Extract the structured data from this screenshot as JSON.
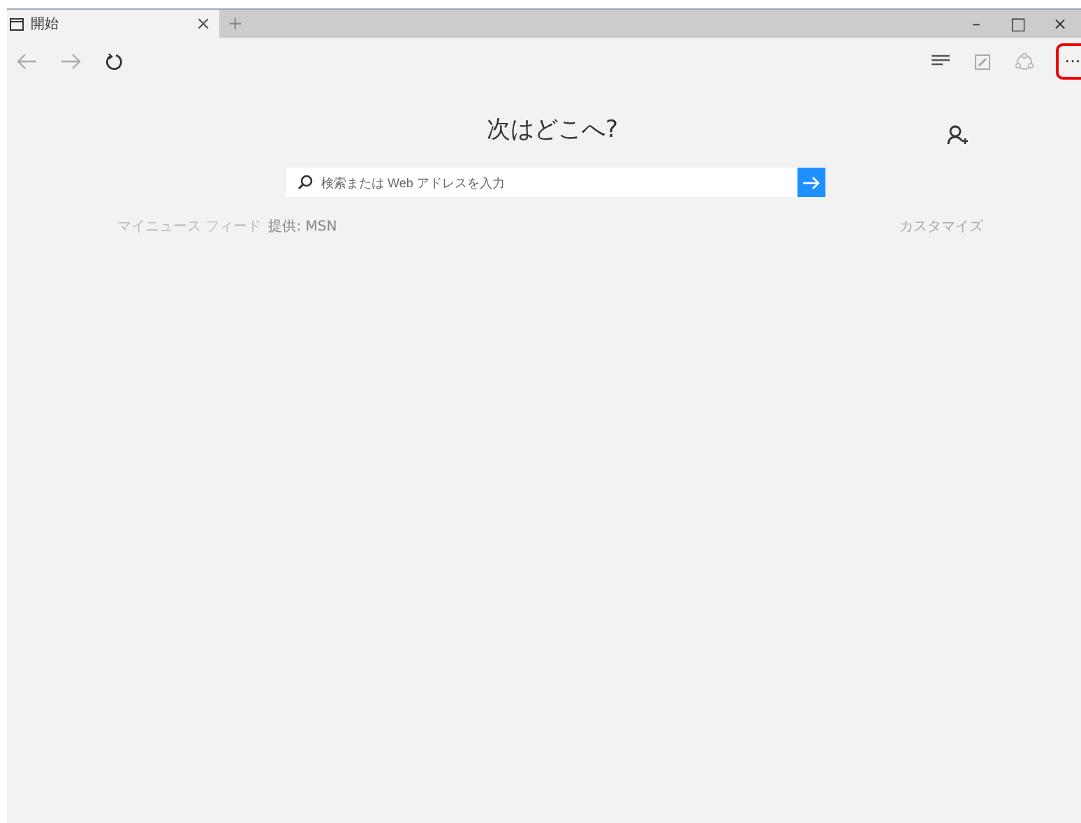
{
  "tab": {
    "title": "開始",
    "close": "×",
    "selected": true
  },
  "new_tab": "+",
  "window_controls": [
    "–",
    "□",
    "×"
  ],
  "more_button": {
    "label": "···",
    "highlighted": true
  },
  "heading": "次はどこへ?",
  "search": {
    "placeholder": "検索または Web アドレスを入力"
  },
  "news": {
    "title": "マイニュース フィード",
    "provider": "提供: MSN",
    "customize": "カスタマイズ"
  }
}
